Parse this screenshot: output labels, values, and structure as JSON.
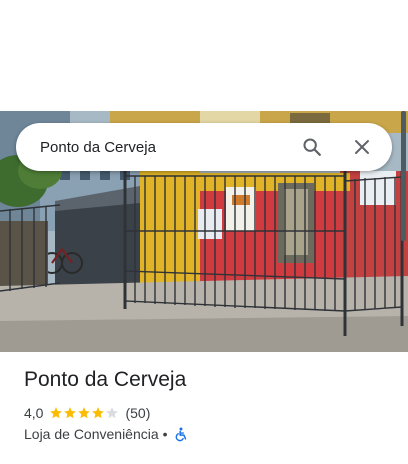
{
  "search": {
    "query": "Ponto da Cerveja"
  },
  "place": {
    "name": "Ponto da Cerveja",
    "rating": "4,0",
    "rating_fraction": 0.8,
    "review_count": "(50)",
    "category": "Loja de Conveniência",
    "separator": "•"
  },
  "icons": {
    "search": "search-icon",
    "close": "close-icon",
    "star": "star-icon",
    "accessibility": "wheelchair-accessible-icon"
  },
  "colors": {
    "star_filled": "#fbbc04",
    "star_empty": "#dadce0",
    "accessibility_icon": "#1a73e8",
    "text_primary": "#202124",
    "text_secondary": "#3c4043"
  }
}
